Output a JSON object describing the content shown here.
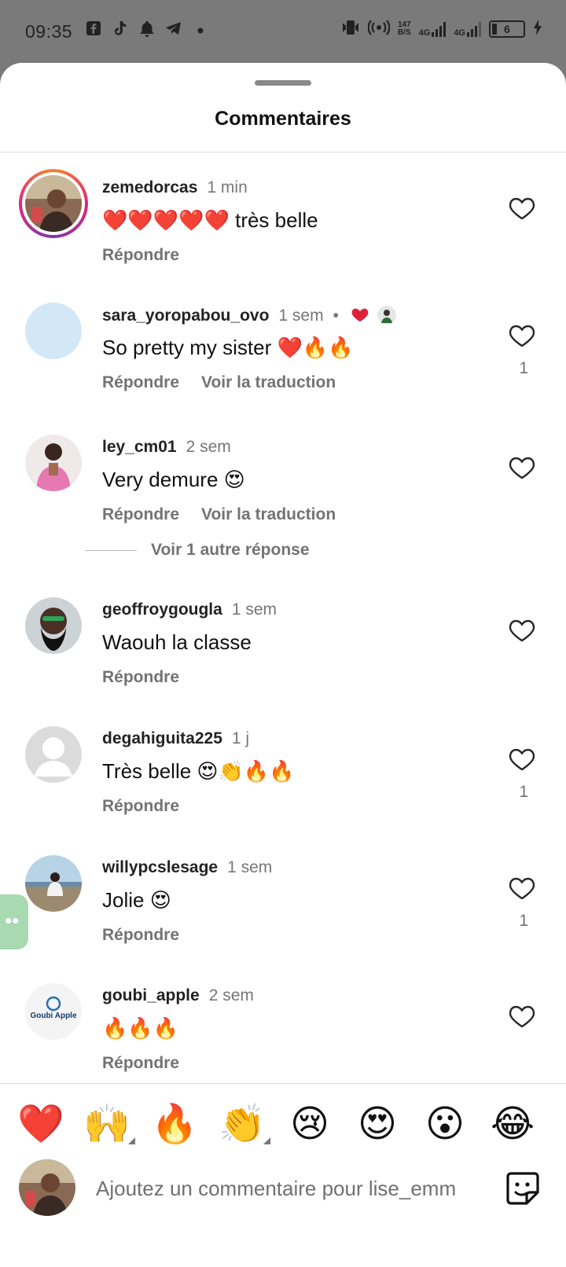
{
  "status_bar": {
    "time": "09:35",
    "left_icons": [
      "facebook-icon",
      "tiktok-icon",
      "bell-icon",
      "telegram-icon",
      "dot-icon"
    ],
    "net_speed_value": "147",
    "net_speed_unit": "B/S",
    "network_1": "4G",
    "network_2": "4G",
    "battery": "6"
  },
  "sheet": {
    "title": "Commentaires"
  },
  "comments": [
    {
      "username": "zemedorcas",
      "time": "1 min",
      "text": "❤️❤️❤️❤️❤️ très belle",
      "reply": "Répondre",
      "translate": "",
      "likes": "",
      "avatar": "story-ring-photo"
    },
    {
      "username": "sara_yoropabou_ovo",
      "time": "1 sem",
      "text": "So pretty my sister ❤️🔥🔥",
      "reply": "Répondre",
      "translate": "Voir la traduction",
      "likes": "1",
      "avatar": "blank-light-blue"
    },
    {
      "username": "ley_cm01",
      "time": "2 sem",
      "text": "Very demure 😍",
      "reply": "Répondre",
      "translate": "Voir la traduction",
      "likes": "",
      "avatar": "photo-pink"
    },
    {
      "username": "geoffroygougla",
      "time": "1 sem",
      "text": "Waouh la classe",
      "reply": "Répondre",
      "translate": "",
      "likes": "",
      "avatar": "photo-beard"
    },
    {
      "username": "degahiguita225",
      "time": "1 j",
      "text": "Très belle 😍👏🔥🔥",
      "reply": "Répondre",
      "translate": "",
      "likes": "1",
      "avatar": "default-person"
    },
    {
      "username": "willypcslesage",
      "time": "1 sem",
      "text": "Jolie 😍",
      "reply": "Répondre",
      "translate": "",
      "likes": "1",
      "avatar": "photo-beach"
    },
    {
      "username": "goubi_apple",
      "time": "2 sem",
      "text": "🔥🔥🔥",
      "reply": "Répondre",
      "translate": "",
      "likes": "",
      "avatar": "logo-goubi-apple",
      "avatar_text": "Goubi Apple"
    }
  ],
  "more_replies": "Voir 1 autre réponse",
  "quick_reactions": [
    "❤️",
    "🙌",
    "🔥",
    "👏",
    "😢",
    "😍",
    "😮",
    "😂"
  ],
  "composer": {
    "placeholder": "Ajoutez un commentaire pour lise_emm"
  },
  "colors": {
    "sheet_bg": "#ffffff",
    "status_bg": "#7a7a7a",
    "muted_text": "#737373",
    "heart_red": "#e0203a"
  }
}
